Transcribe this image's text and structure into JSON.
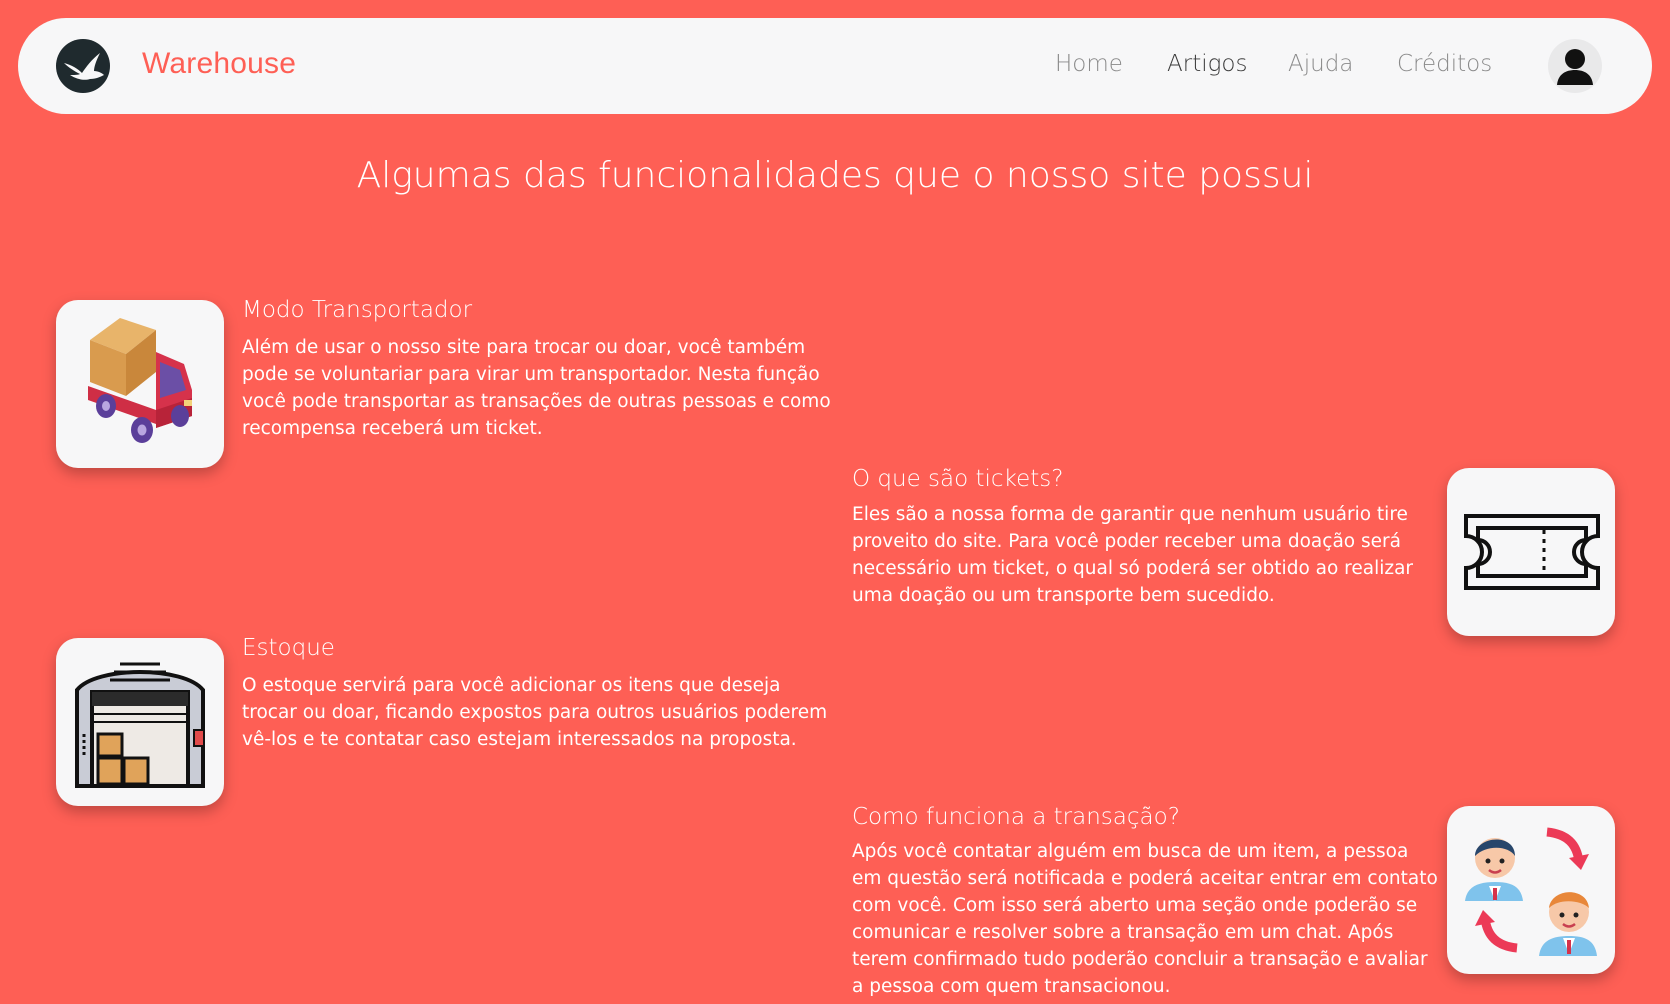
{
  "nav": {
    "brand": "Warehouse",
    "links": [
      "Home",
      "Artigos",
      "Ajuda",
      "Créditos"
    ],
    "active": "Artigos"
  },
  "page_title": "Algumas das funcionalidades que o nosso site possui",
  "features": [
    {
      "title": "Modo Transportador",
      "text": "Além de usar o nosso site para trocar ou doar, você também pode se voluntariar para virar um transportador. Nesta função você pode transportar as transações de outras pessoas e como recompensa receberá um ticket.",
      "icon": "delivery-truck-icon"
    },
    {
      "title": "O que são tickets?",
      "text": "Eles são a nossa forma de garantir que nenhum usuário tire proveito do site. Para você poder receber uma doação será necessário um ticket, o qual só poderá ser obtido ao realizar uma doação ou um transporte bem sucedido.",
      "icon": "ticket-icon"
    },
    {
      "title": "Estoque",
      "text": "O estoque servirá para você adicionar os itens que deseja trocar ou doar, ficando expostos para outros usuários poderem vê-los e te contatar caso estejam interessados na proposta.",
      "icon": "warehouse-icon"
    },
    {
      "title": "Como funciona a transação?",
      "text": "Após você contatar alguém em busca de um item, a pessoa em questão será notificada e poderá aceitar entrar em contato com você. Com isso será aberto uma seção onde poderão se comunicar e resolver sobre a transação em um chat. Após terem confirmado tudo poderão concluir a transação e avaliar a pessoa com quem transacionou.",
      "icon": "people-exchange-icon"
    }
  ],
  "colors": {
    "background": "#fe5f55",
    "navbar": "#f7f7f8",
    "brand": "#fe5f55"
  }
}
